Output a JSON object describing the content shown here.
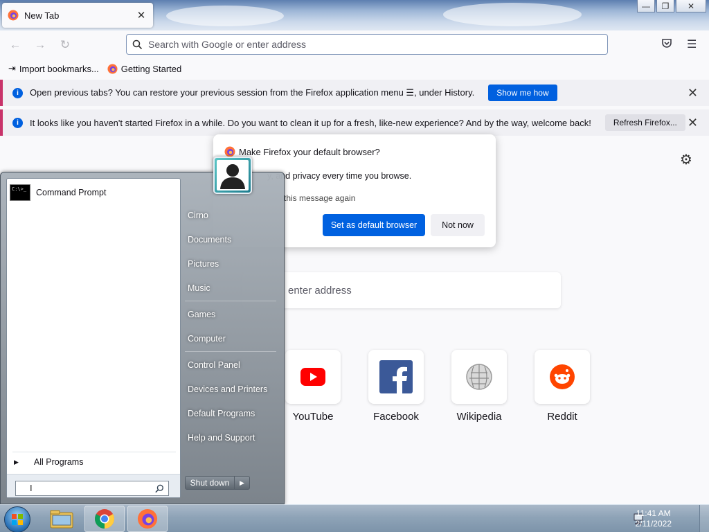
{
  "browser": {
    "tab_title": "New Tab",
    "tab_close": "✕",
    "url_placeholder": "Search with Google or enter address",
    "bookmarks": [
      "Import bookmarks...",
      "Getting Started"
    ],
    "window_controls": {
      "minimize": "—",
      "restore": "❐",
      "close": "✕"
    }
  },
  "notifications": [
    {
      "text": "Open previous tabs? You can restore your previous session from the Firefox application menu ☰, under History.",
      "button": "Show me how",
      "close": "✕"
    },
    {
      "text": "It looks like you haven't started Firefox in a while. Do you want to clean it up for a fresh, like-new experience? And by the way, welcome back!",
      "button": "Refresh Firefox...",
      "close": "✕"
    }
  ],
  "newtab": {
    "search_placeholder": "enter address",
    "tiles": [
      {
        "label": "YouTube",
        "icon": "youtube-icon"
      },
      {
        "label": "Facebook",
        "icon": "facebook-icon"
      },
      {
        "label": "Wikipedia",
        "icon": "wikipedia-icon"
      },
      {
        "label": "Reddit",
        "icon": "reddit-icon"
      }
    ]
  },
  "dialog": {
    "title": "Make Firefox your default browser?",
    "text": "y, and privacy every time you browse.",
    "checkbox_text": "this message again",
    "primary_button": "Set as default browser",
    "secondary_button": "Not now"
  },
  "start_menu": {
    "pinned_program": "Command Prompt",
    "cmd_icon_text": "C:\\>_",
    "all_programs": "All Programs",
    "right_items": [
      "Cirno",
      "Documents",
      "Pictures",
      "Music",
      "Games",
      "Computer",
      "Control Panel",
      "Devices and Printers",
      "Default Programs",
      "Help and Support"
    ],
    "shutdown": "Shut down"
  },
  "taskbar": {
    "time": "11:41 AM",
    "date": "2/11/2022"
  },
  "colors": {
    "accent": "#0061e0",
    "notification_bar": "#c8336a",
    "youtube": "#ff0000",
    "facebook": "#1877f2",
    "reddit": "#ff4500"
  }
}
